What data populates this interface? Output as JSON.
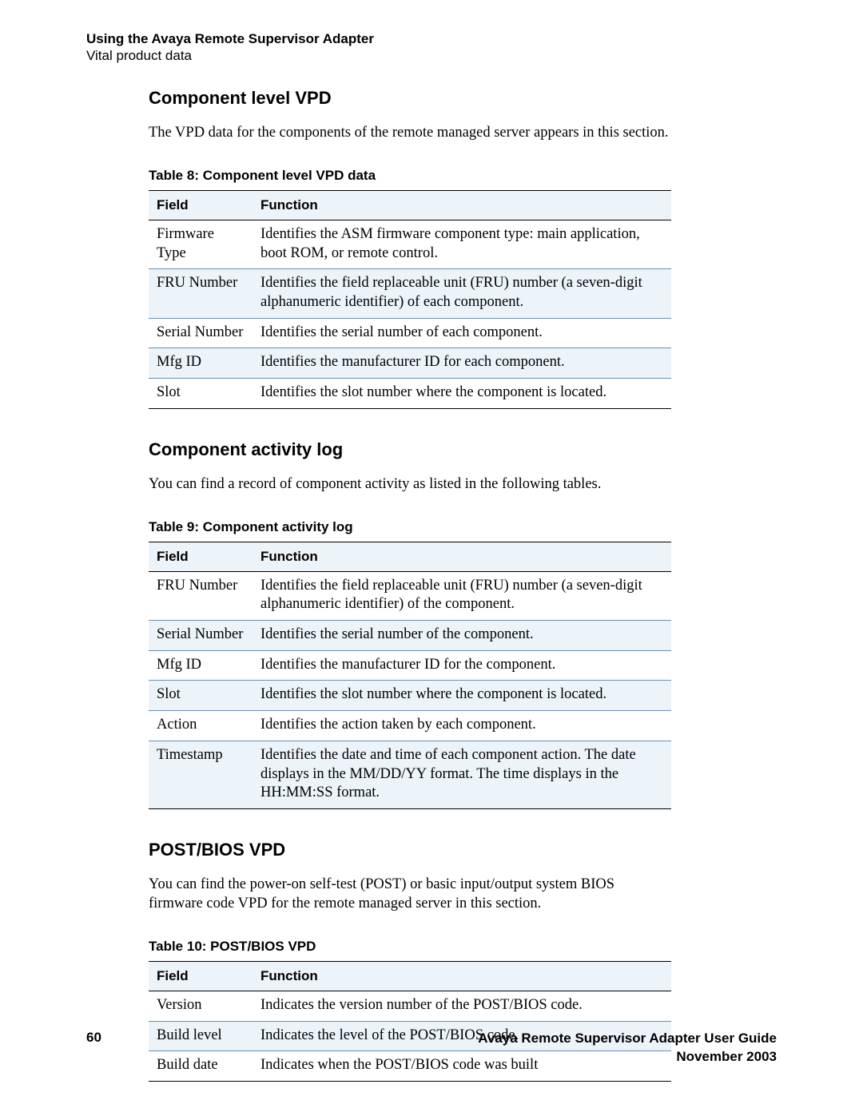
{
  "header": {
    "title": "Using the Avaya Remote Supervisor Adapter",
    "subtitle": "Vital product data"
  },
  "section1": {
    "heading": "Component level VPD",
    "intro": "The VPD data for the components of the remote managed server appears in this section.",
    "table_caption": "Table 8: Component level VPD data",
    "table_header_field": "Field",
    "table_header_function": "Function",
    "rows": [
      {
        "field": "Firmware Type",
        "function": "Identifies the ASM firmware component type: main application, boot ROM, or remote control."
      },
      {
        "field": "FRU Number",
        "function": "Identifies the field replaceable unit (FRU) number (a seven-digit alphanumeric identifier) of each component."
      },
      {
        "field": "Serial Number",
        "function": "Identifies the serial number of each component."
      },
      {
        "field": "Mfg ID",
        "function": "Identifies the manufacturer ID for each component."
      },
      {
        "field": "Slot",
        "function": "Identifies the slot number where the component is located."
      }
    ]
  },
  "section2": {
    "heading": "Component activity log",
    "intro": "You can find a record of component activity as listed in the following tables.",
    "table_caption": "Table 9: Component activity log",
    "table_header_field": "Field",
    "table_header_function": "Function",
    "rows": [
      {
        "field": "FRU Number",
        "function": "Identifies the field replaceable unit (FRU) number (a seven-digit alphanumeric identifier) of the component."
      },
      {
        "field": "Serial Number",
        "function": "Identifies the serial number of the component."
      },
      {
        "field": "Mfg ID",
        "function": "Identifies the manufacturer ID for the component."
      },
      {
        "field": "Slot",
        "function": "Identifies the slot number where the component is located."
      },
      {
        "field": "Action",
        "function": "Identifies the action taken by each component."
      },
      {
        "field": "Timestamp",
        "function": "Identifies the date and time of each component action. The date displays in the MM/DD/YY format. The time displays in the HH:MM:SS format."
      }
    ]
  },
  "section3": {
    "heading": "POST/BIOS VPD",
    "intro": "You can find the power-on self-test (POST) or basic input/output system BIOS firmware code VPD for the remote managed server in this section.",
    "table_caption": "Table 10: POST/BIOS VPD",
    "table_header_field": "Field",
    "table_header_function": "Function",
    "rows": [
      {
        "field": "Version",
        "function": "Indicates the version number of the POST/BIOS code."
      },
      {
        "field": "Build level",
        "function": "Indicates the level of the POST/BIOS code."
      },
      {
        "field": "Build date",
        "function": "Indicates when the POST/BIOS code was built"
      }
    ]
  },
  "footer": {
    "page": "60",
    "guide_line1": "Avaya Remote Supervisor Adapter User Guide",
    "guide_line2": "November 2003"
  }
}
